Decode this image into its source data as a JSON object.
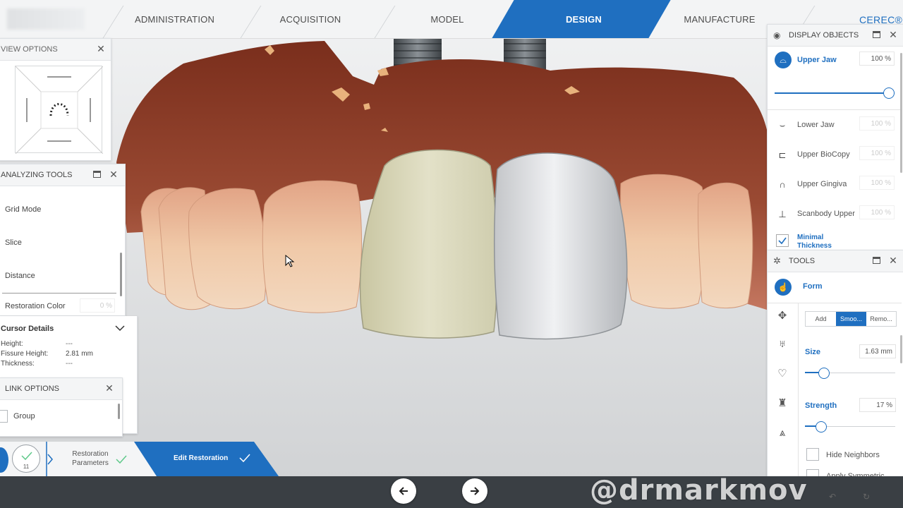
{
  "nav": {
    "tabs": [
      "ADMINISTRATION",
      "ACQUISITION",
      "MODEL",
      "DESIGN",
      "MANUFACTURE"
    ],
    "active": "DESIGN",
    "brand": "CEREC®"
  },
  "view_options": {
    "title": "VIEW OPTIONS"
  },
  "analyzing_tools": {
    "title": "ANALYZING TOOLS",
    "items": [
      "Grid Mode",
      "Slice",
      "Distance"
    ],
    "restoration_color": {
      "label": "Restoration Color",
      "value": "0 %"
    }
  },
  "cursor_details": {
    "title": "Cursor Details",
    "rows": [
      {
        "label": "Height:",
        "value": "---"
      },
      {
        "label": "Fissure Height:",
        "value": "2.81 mm"
      },
      {
        "label": "Thickness:",
        "value": "---"
      }
    ]
  },
  "link_options": {
    "title": "LINK OPTIONS",
    "group_label": "Group"
  },
  "display_objects": {
    "title": "DISPLAY OBJECTS",
    "active": {
      "label": "Upper Jaw",
      "value": "100 %",
      "opacity": 1.0
    },
    "items": [
      {
        "label": "Lower Jaw",
        "value": "100 %",
        "icon": "lower-jaw-icon"
      },
      {
        "label": "Upper BioCopy",
        "value": "100 %",
        "icon": "biocopy-icon"
      },
      {
        "label": "Upper Gingiva",
        "value": "100 %",
        "icon": "gingiva-icon"
      },
      {
        "label": "Scanbody Upper",
        "value": "100 %",
        "icon": "scanbody-icon"
      }
    ],
    "minimal_thickness": "Minimal Thickness"
  },
  "tools": {
    "title": "TOOLS",
    "mode": "Form",
    "segments": [
      "Add",
      "Smoo...",
      "Remo..."
    ],
    "active_segment": "Smoo...",
    "size": {
      "label": "Size",
      "value": "1.63 mm",
      "level": 0.2
    },
    "strength": {
      "label": "Strength",
      "value": "17 %",
      "level": 0.17
    },
    "hide_neighbors": "Hide Neighbors",
    "apply_symmetric": "Apply Symmetric"
  },
  "workflow": {
    "step_count": "11",
    "steps": [
      {
        "label": "Restoration Parameters"
      },
      {
        "label": "Edit Restoration"
      }
    ]
  },
  "watermark": "@drmarkmov",
  "colors": {
    "accent": "#1f6fc0",
    "gingiva": "#8a3b26",
    "check": "#5fc98a"
  }
}
